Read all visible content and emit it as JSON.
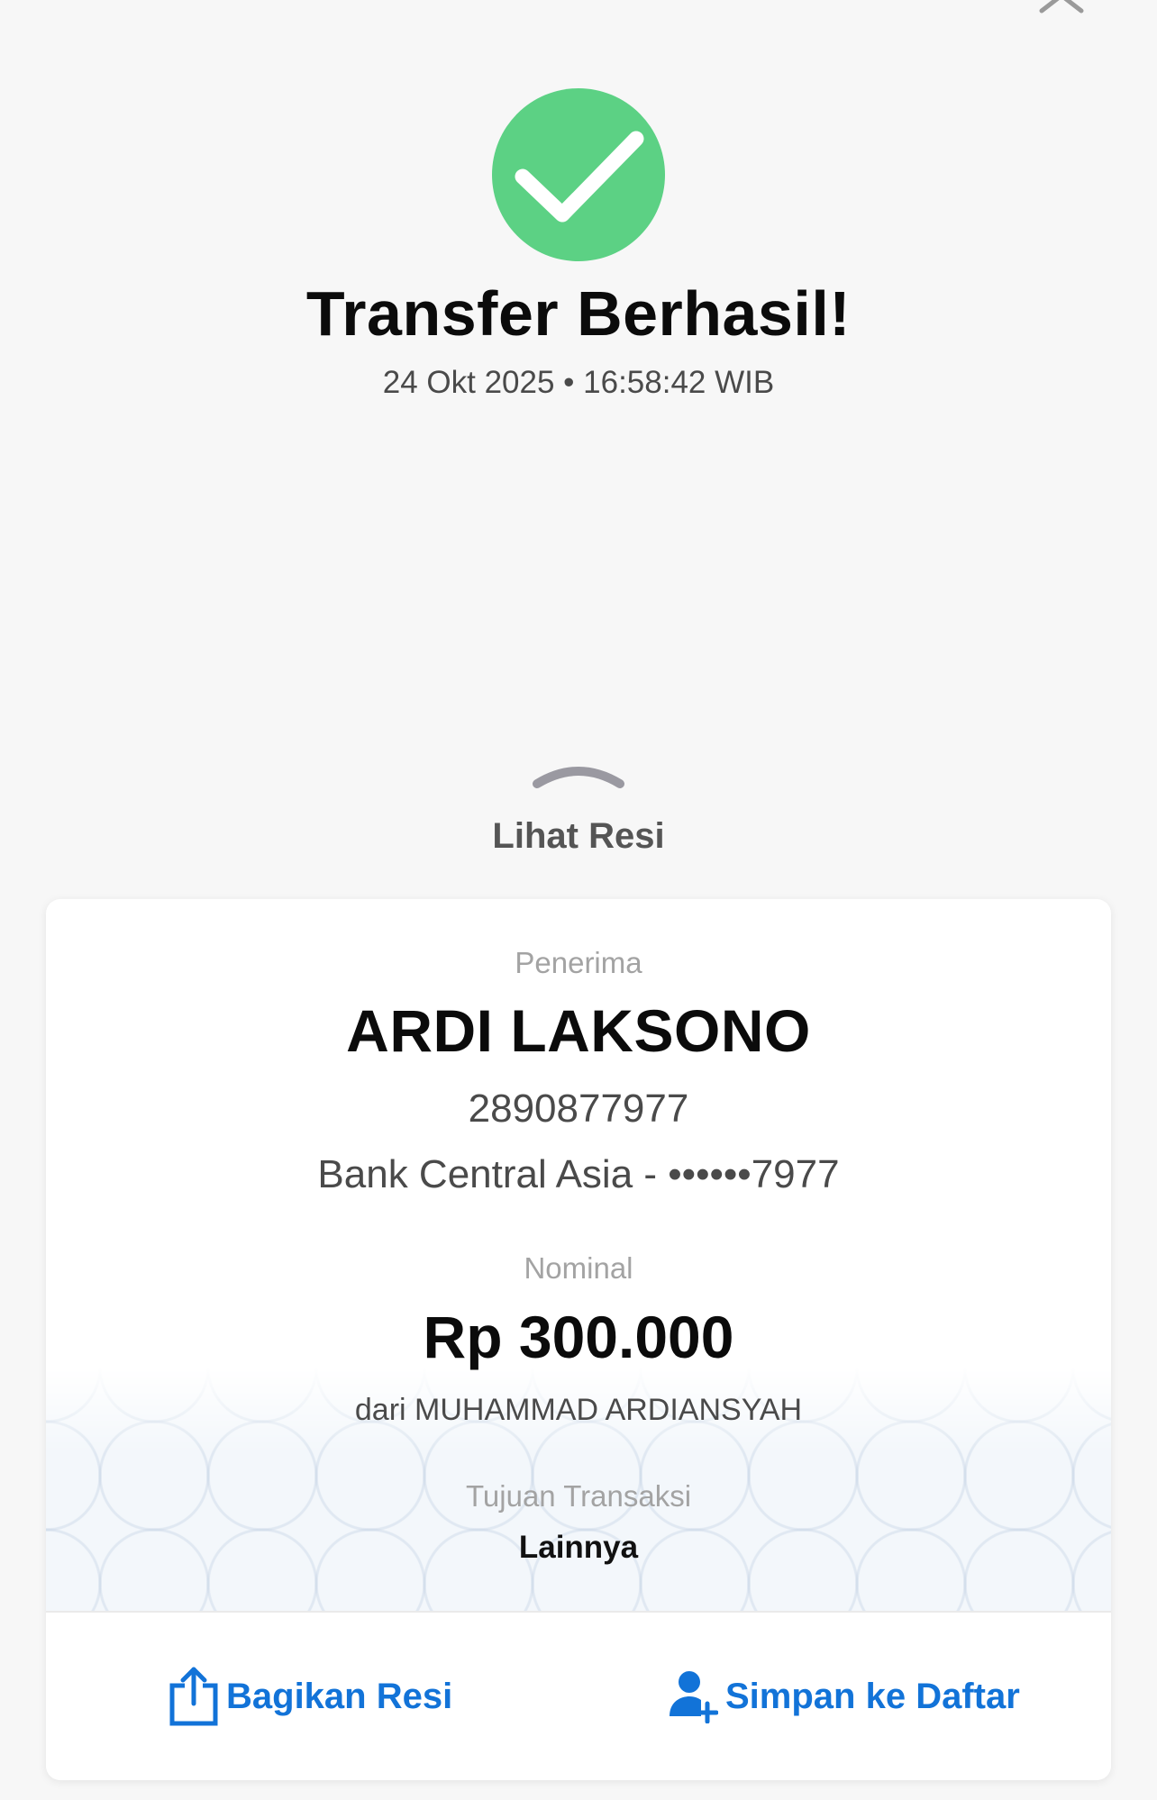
{
  "header": {
    "title": "Transfer Berhasil!",
    "timestamp": "24 Okt 2025 • 16:58:42 WIB",
    "close_icon": "close-icon",
    "status_icon": "check-circle-icon"
  },
  "receipt_toggle": {
    "label": "Lihat Resi",
    "icon": "chevron-up-icon"
  },
  "receipt": {
    "recipient_label": "Penerima",
    "recipient_name": "ARDI LAKSONO",
    "account_number": "2890877977",
    "bank_line": "Bank Central Asia - ••••••7977",
    "amount_label": "Nominal",
    "amount": "Rp 300.000",
    "sender_line": "dari MUHAMMAD ARDIANSYAH",
    "purpose_label": "Tujuan Transaksi",
    "purpose_value": "Lainnya"
  },
  "actions": {
    "share_label": "Bagikan Resi",
    "share_icon": "share-icon",
    "save_label": "Simpan ke Daftar",
    "save_icon": "add-user-icon"
  },
  "colors": {
    "success": "#5cd184",
    "accent": "#1273d8",
    "background": "#f7f7f7"
  }
}
